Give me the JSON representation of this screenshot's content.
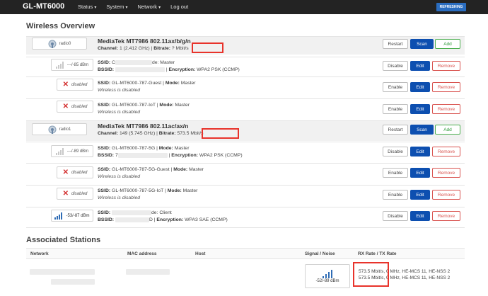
{
  "nav": {
    "brand": "GL-MT6000",
    "menu": [
      "Status",
      "System",
      "Network"
    ],
    "logout": "Log out",
    "refreshing": "REFRESHING",
    "caret": "▾"
  },
  "wireless": {
    "title": "Wireless Overview",
    "radio0": {
      "badge": "radio0",
      "title": "MediaTek MT7986 802.11ax/b/g/n",
      "channel_label": "Channel:",
      "channel": "1 (2.412 GHz)",
      "bitrate_label": "Bitrate:",
      "bitrate": "? Mbit/s"
    },
    "radio1": {
      "badge": "radio1",
      "title": "MediaTek MT7986 802.11ac/ax/n",
      "channel_label": "Channel:",
      "channel": "149 (5.745 GHz)",
      "bitrate_label": "Bitrate:",
      "bitrate": "573.5 Mbit/s"
    },
    "labels": {
      "ssid": "SSID:",
      "bssid": "BSSID:",
      "mode": "Mode:",
      "encryption": "Encryption:",
      "disabled": "disabled",
      "wireless_disabled": "Wireless is disabled"
    },
    "buttons": {
      "restart": "Restart",
      "scan": "Scan",
      "add": "Add",
      "disable": "Disable",
      "enable": "Enable",
      "edit": "Edit",
      "remove": "Remove"
    },
    "networks": [
      {
        "signal": "---/-85 dBm",
        "ssid_prefix": "",
        "mode_suffix": "de: Master",
        "encryption": "WPA2 PSK (CCMP)"
      },
      {
        "ssid": "GL-MT6000-787-Guest",
        "mode": "Master"
      },
      {
        "ssid": "GL-MT6000-787-IoT",
        "mode": "Master"
      },
      {
        "signal": "---/-89 dBm",
        "ssid": "GL-MT6000-787-5G",
        "mode": "Master",
        "bssid_prefix": "7",
        "encryption": "WPA2 PSK (CCMP)"
      },
      {
        "ssid": "GL-MT6000-787-5G-Guest",
        "mode": "Master"
      },
      {
        "ssid": "GL-MT6000-787-5G-IoT",
        "mode": "Master"
      },
      {
        "signal": "-53/-87 dBm",
        "mode_suffix": "de: Client",
        "bssid_suffix": "D",
        "encryption": "WPA3 SAE (CCMP)"
      }
    ]
  },
  "stations": {
    "title": "Associated Stations",
    "headers": [
      "Network",
      "MAC address",
      "Host",
      "Signal / Noise",
      "RX Rate / TX Rate"
    ],
    "row": {
      "signal": "-52/-89 dBm",
      "rx_rate": "573.5 Mbit/s,",
      "rx_rest": "0 MHz, HE-MCS 11, HE-NSS 2",
      "tx_rate": "573.5 Mbit/s,",
      "tx_rest": "0 MHz, HE-MCS 11, HE-NSS 2"
    }
  }
}
